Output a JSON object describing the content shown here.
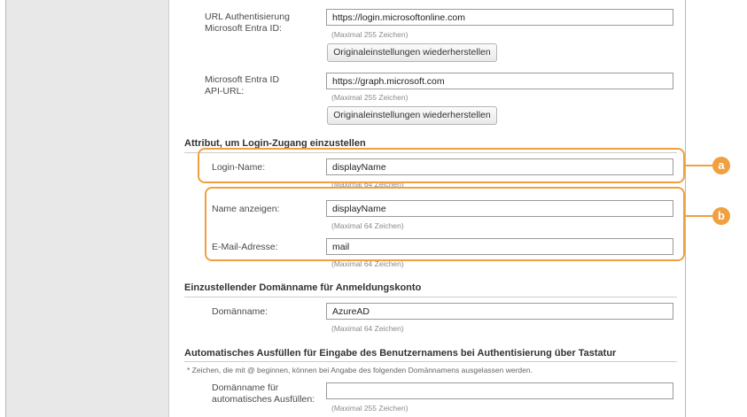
{
  "entra_auth_url": {
    "label_line1": "URL Authentisierung",
    "label_line2": "Microsoft Entra ID:",
    "value": "https://login.microsoftonline.com",
    "hint": "(Maximal 255 Zeichen)",
    "restore_button": "Originaleinstellungen wiederherstellen"
  },
  "entra_api_url": {
    "label_line1": "Microsoft Entra ID",
    "label_line2": "API-URL:",
    "value": "https://graph.microsoft.com",
    "hint": "(Maximal 255 Zeichen)",
    "restore_button": "Originaleinstellungen wiederherstellen"
  },
  "login_attr_section": {
    "heading": "Attribut, um Login-Zugang einzustellen"
  },
  "login_name": {
    "label": "Login-Name:",
    "value": "displayName",
    "hint": "(Maximal 64 Zeichen)"
  },
  "display_name": {
    "label": "Name anzeigen:",
    "value": "displayName",
    "hint": "(Maximal 64 Zeichen)"
  },
  "email": {
    "label": "E-Mail-Adresse:",
    "value": "mail",
    "hint": "(Maximal 64 Zeichen)"
  },
  "domain_section": {
    "heading": "Einzustellender Domänname für Anmeldungskonto",
    "label": "Domänname:",
    "value": "AzureAD",
    "hint": "(Maximal 64 Zeichen)"
  },
  "autofill_section": {
    "heading": "Automatisches Ausfüllen für Eingabe des Benutzernamens bei Authentisierung über Tastatur",
    "note": "* Zeichen, die mit @ beginnen, können bei Angabe des folgenden Domännamens ausgelassen werden.",
    "label_line1": "Domänname für",
    "label_line2": "automatisches Ausfüllen:",
    "value": "",
    "hint": "(Maximal 255 Zeichen)"
  },
  "callouts": {
    "a": "a",
    "b": "b",
    "color": "#f0a040"
  }
}
